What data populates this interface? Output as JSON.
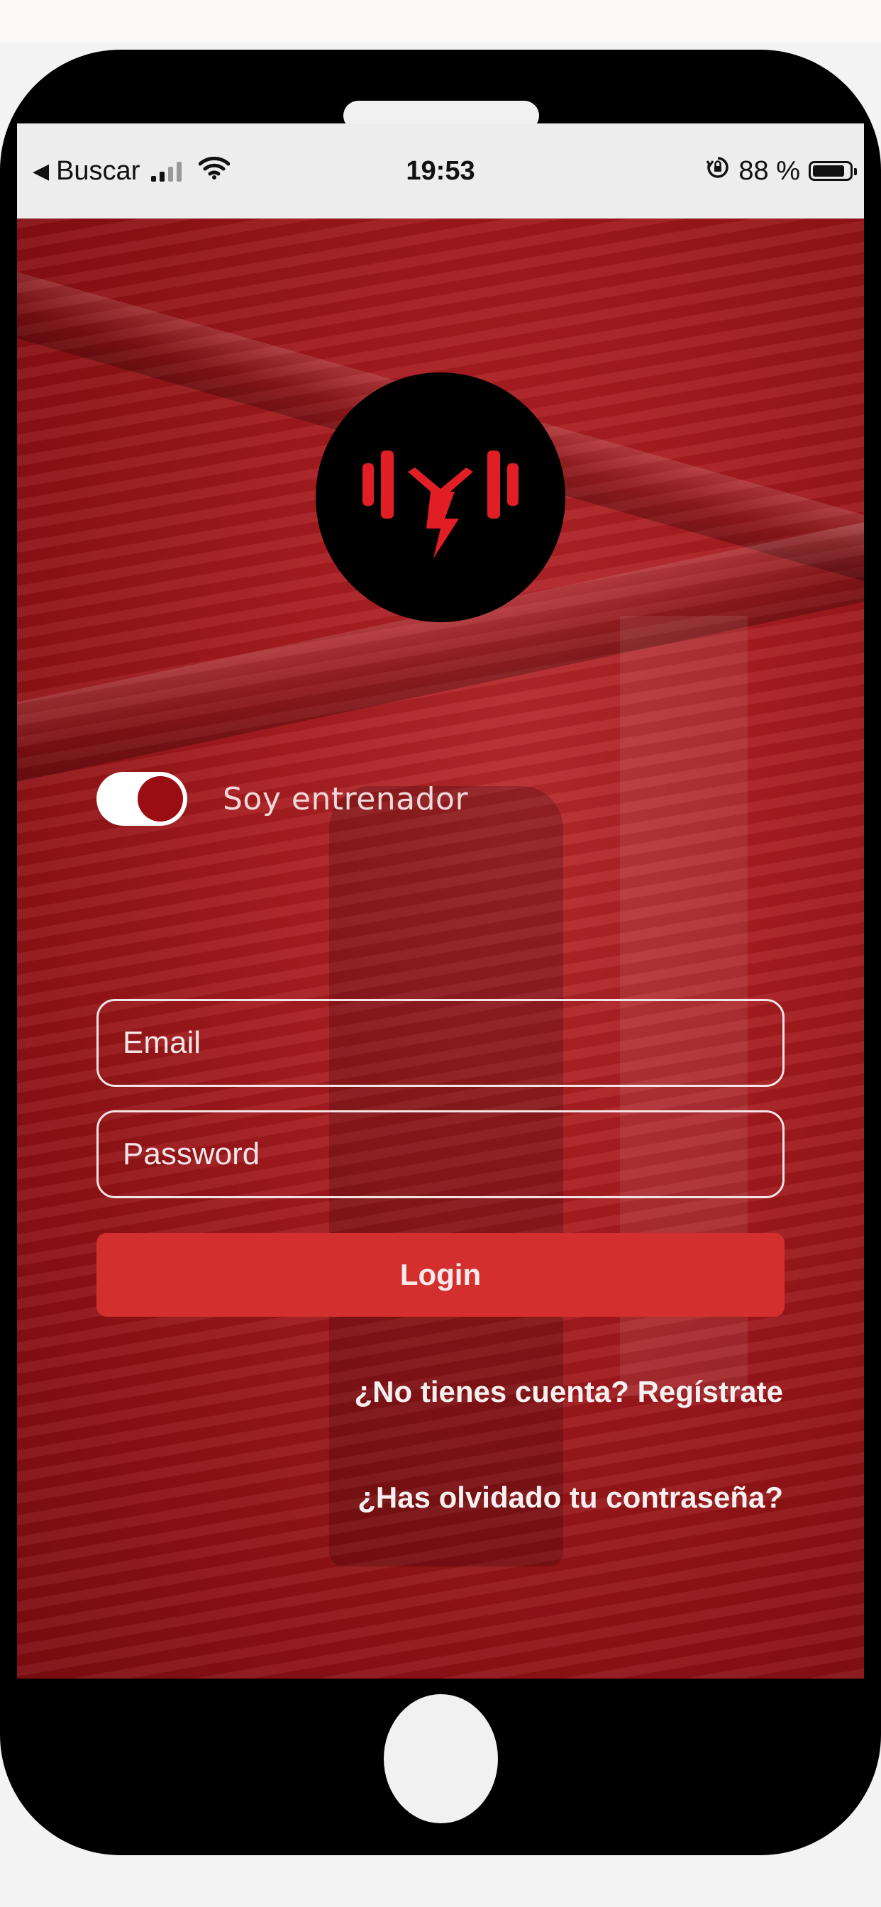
{
  "status_bar": {
    "back_label": "Buscar",
    "time": "19:53",
    "battery_percent_text": "88 %",
    "battery_level": 0.88,
    "icons": [
      "back-arrow-icon",
      "cellular-signal-icon",
      "wifi-icon",
      "rotation-lock-icon",
      "battery-icon"
    ]
  },
  "logo": {
    "icon": "barbell-lightning-logo",
    "colors": {
      "background": "#000000",
      "mark": "#e01e24"
    }
  },
  "trainer_toggle": {
    "label": "Soy entrenador",
    "on": true
  },
  "form": {
    "email_placeholder": "Email",
    "password_placeholder": "Password",
    "login_label": "Login"
  },
  "links": {
    "register": "¿No tienes cuenta? Regístrate",
    "forgot_password": "¿Has olvidado tu contraseña?"
  },
  "colors": {
    "accent": "#d32f2f",
    "overlay": "#a81c20"
  }
}
